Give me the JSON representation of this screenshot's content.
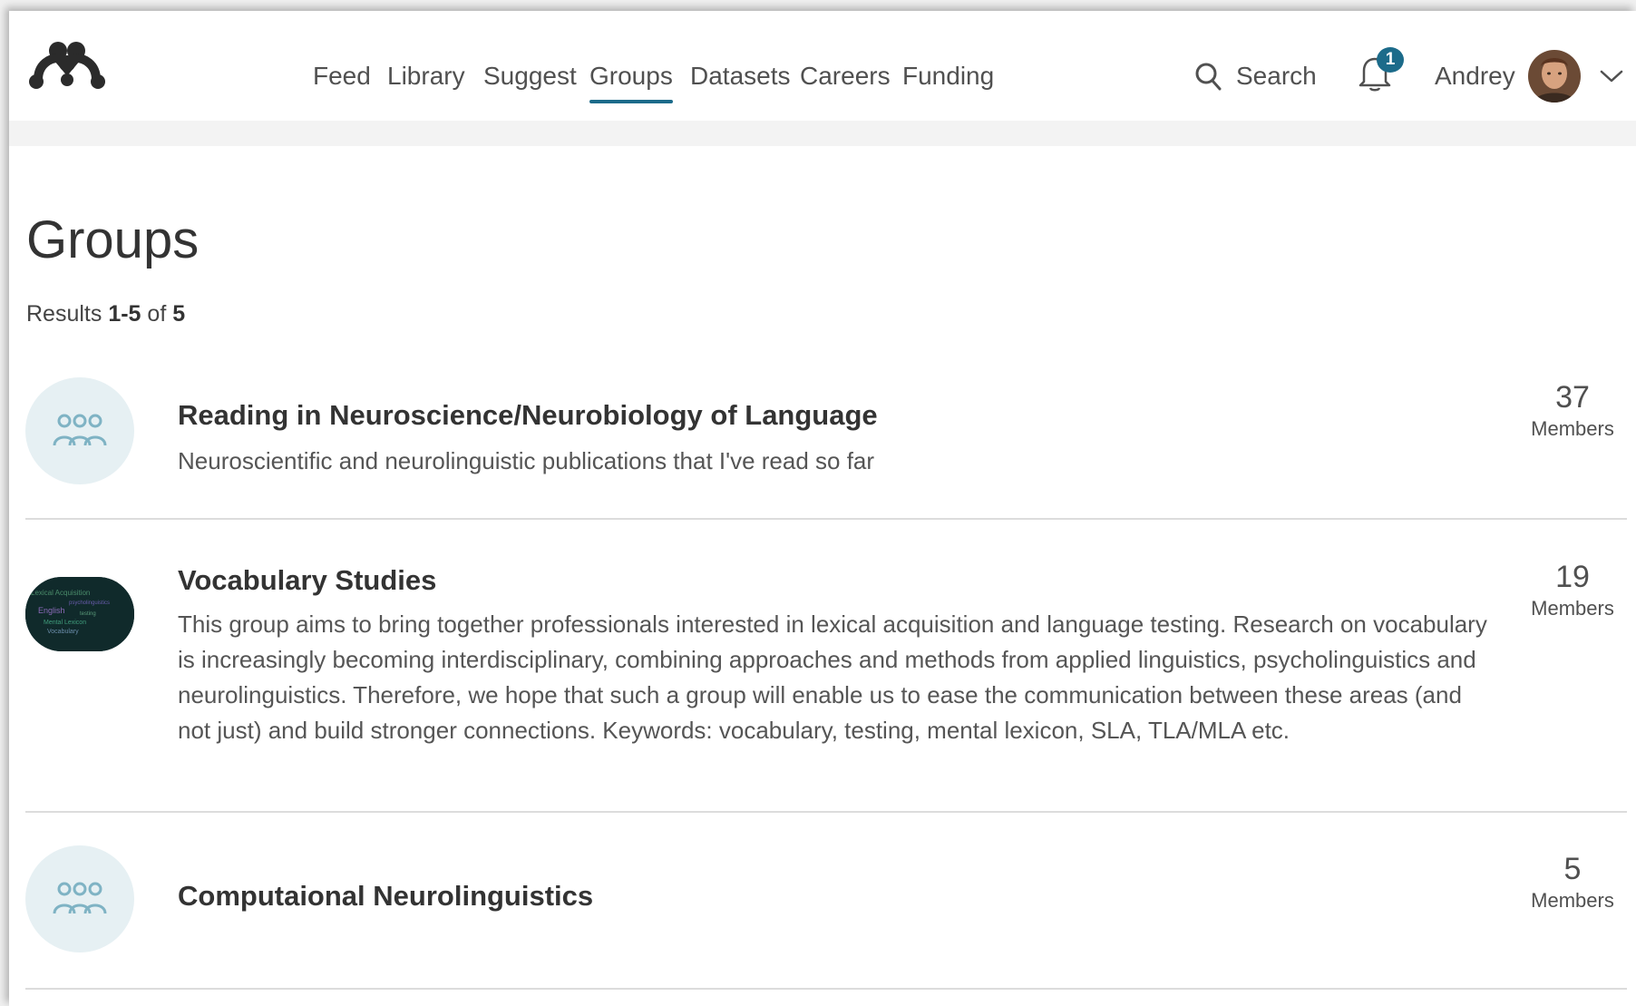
{
  "nav": {
    "items": [
      {
        "label": "Feed"
      },
      {
        "label": "Library"
      },
      {
        "label": "Suggest"
      },
      {
        "label": "Groups",
        "active": true
      },
      {
        "label": "Datasets"
      },
      {
        "label": "Careers"
      },
      {
        "label": "Funding"
      }
    ],
    "search_label": "Search",
    "notification_count": "1",
    "user_name": "Andrey"
  },
  "page": {
    "title": "Groups",
    "results_prefix": "Results",
    "results_range": "1-5",
    "results_of": "of",
    "results_total": "5"
  },
  "groups": [
    {
      "title": "Reading in Neuroscience/Neurobiology of Language",
      "description": "Neuroscientific and neurolinguistic publications that I've read so far",
      "members": "37",
      "members_label": "Members",
      "icon": "group-people-icon"
    },
    {
      "title": "Vocabulary Studies",
      "description": "This group aims to bring together professionals interested in lexical acquisition and language testing. Research on vocabulary is increasingly becoming interdisciplinary, combining approaches and methods from applied linguistics, psycholinguistics and neurolinguistics. Therefore, we hope that such a group will enable us to ease the communication between these areas (and not just) and build stronger connections. Keywords: vocabulary, testing, mental lexicon, SLA, TLA/MLA etc.",
      "members": "19",
      "members_label": "Members",
      "icon": "word-cloud-image"
    },
    {
      "title": "Computaional Neurolinguistics",
      "description": "",
      "members": "5",
      "members_label": "Members",
      "icon": "group-people-icon"
    }
  ],
  "colors": {
    "accent": "#1c6b8a",
    "icon_bg": "#e6f0f3",
    "icon_fg": "#7fb3c4"
  }
}
